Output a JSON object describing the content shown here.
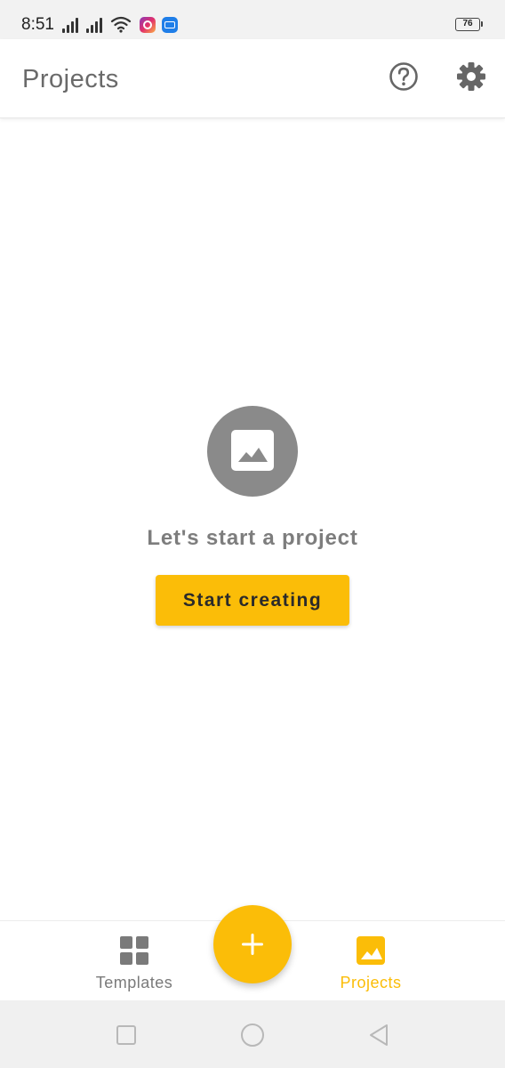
{
  "status_bar": {
    "time": "8:51",
    "battery": "76",
    "icons": [
      "signal-icon",
      "signal-icon",
      "wifi-icon",
      "instagram-icon",
      "mail-app-icon",
      "battery-icon"
    ]
  },
  "header": {
    "title": "Projects",
    "icons": [
      "help-icon",
      "settings-icon"
    ]
  },
  "empty_state": {
    "icon": "image-icon",
    "title": "Let's start a project",
    "button_label": "Start creating"
  },
  "bottom_nav": {
    "items": [
      {
        "label": "Templates",
        "icon": "grid-icon",
        "active": false
      },
      {
        "label": "Projects",
        "icon": "image-icon",
        "active": true
      }
    ],
    "fab_icon": "plus-icon"
  },
  "system_nav": {
    "icons": [
      "recents-icon",
      "home-icon",
      "back-icon"
    ]
  },
  "colors": {
    "accent": "#fbbd08",
    "icon_gray": "#8a8a8a",
    "title_gray": "#6a6a6a",
    "background": "#ffffff"
  }
}
